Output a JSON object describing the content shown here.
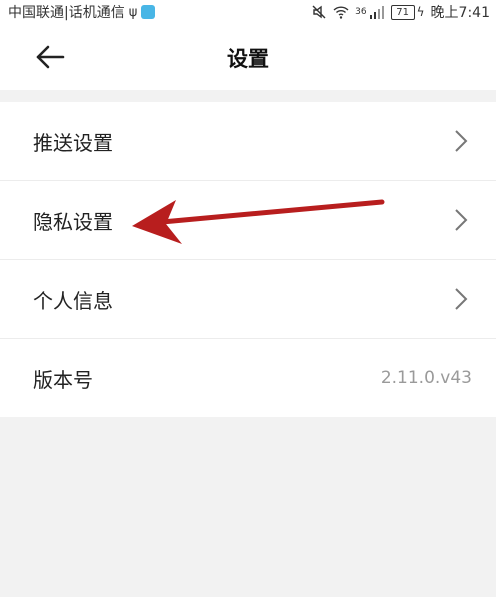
{
  "status_bar": {
    "carrier": "中国联通|话机通信",
    "battery": "71",
    "time": "晚上7:41",
    "network": "36"
  },
  "app_bar": {
    "title": "设置",
    "back_icon": "back-arrow-icon"
  },
  "menu": {
    "items": [
      {
        "label": "推送设置",
        "icon": "chevron-right-icon"
      },
      {
        "label": "隐私设置",
        "icon": "chevron-right-icon"
      },
      {
        "label": "个人信息",
        "icon": "chevron-right-icon"
      },
      {
        "label": "版本号",
        "value": "2.11.0.v43"
      }
    ]
  },
  "annotation": {
    "arrow_color": "#b81e1e",
    "points_to": "隐私设置"
  },
  "colors": {
    "background": "#f2f2f2",
    "surface": "#ffffff",
    "text": "#222222",
    "muted": "#9a9a9a"
  }
}
